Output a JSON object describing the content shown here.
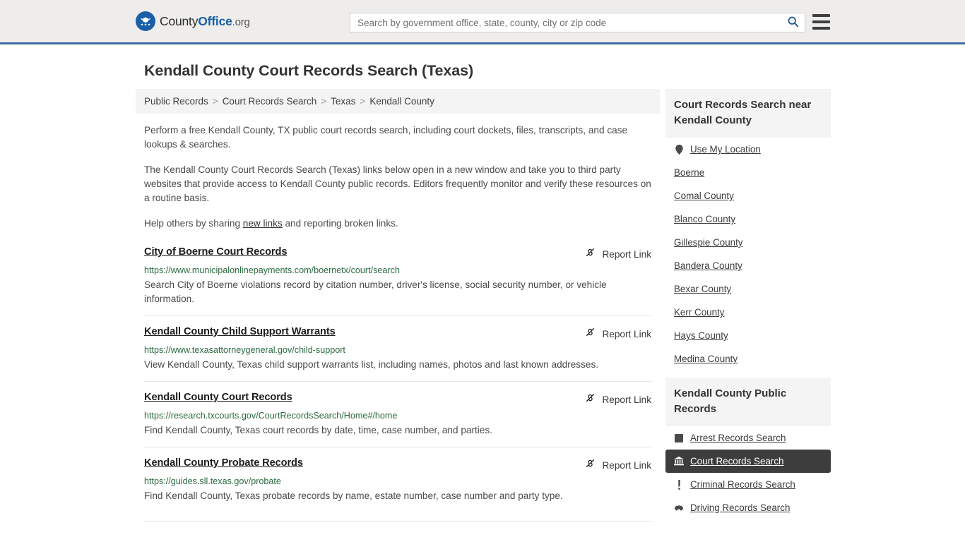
{
  "header": {
    "logo": {
      "part1": "County",
      "part2": "Office",
      "tld": ".org",
      "icon": "eagle-seal-icon"
    },
    "search": {
      "placeholder": "Search by government office, state, county, city or zip code",
      "value": ""
    },
    "search_icon": "search-icon",
    "menu_icon": "hamburger-menu-icon",
    "accent_color": "#3a6ea5",
    "background_color": "#eeedeb"
  },
  "page_title": "Kendall County Court Records Search (Texas)",
  "breadcrumb": {
    "items": [
      {
        "label": "Public Records"
      },
      {
        "label": "Court Records Search"
      },
      {
        "label": "Texas"
      },
      {
        "label": "Kendall County"
      }
    ],
    "separator": ">"
  },
  "intro": {
    "p1": "Perform a free Kendall County, TX public court records search, including court dockets, files, transcripts, and case lookups & searches.",
    "p2": "The Kendall County Court Records Search (Texas) links below open in a new window and take you to third party websites that provide access to Kendall County public records. Editors frequently monitor and verify these resources on a routine basis.",
    "p3_before": "Help others by sharing ",
    "p3_link": "new links",
    "p3_after": " and reporting broken links."
  },
  "results": {
    "report_label": "Report Link",
    "report_icon": "broken-link-icon",
    "items": [
      {
        "title": "City of Boerne Court Records",
        "url": "https://www.municipalonlinepayments.com/boernetx/court/search",
        "description": "Search City of Boerne violations record by citation number, driver's license, social security number, or vehicle information."
      },
      {
        "title": "Kendall County Child Support Warrants",
        "url": "https://www.texasattorneygeneral.gov/child-support",
        "description": "View Kendall County, Texas child support warrants list, including names, photos and last known addresses."
      },
      {
        "title": "Kendall County Court Records",
        "url": "https://research.txcourts.gov/CourtRecordsSearch/Home#/home",
        "description": "Find Kendall County, Texas court records by date, time, case number, and parties."
      },
      {
        "title": "Kendall County Probate Records",
        "url": "https://guides.sll.texas.gov/probate",
        "description": "Find Kendall County, Texas probate records by name, estate number, case number and party type."
      }
    ]
  },
  "sidebar": {
    "nearby": {
      "title": "Court Records Search near Kendall County",
      "items": [
        {
          "label": "Use My Location",
          "icon": "location-pin-icon"
        },
        {
          "label": "Boerne",
          "icon": ""
        },
        {
          "label": "Comal County",
          "icon": ""
        },
        {
          "label": "Blanco County",
          "icon": ""
        },
        {
          "label": "Gillespie County",
          "icon": ""
        },
        {
          "label": "Bandera County",
          "icon": ""
        },
        {
          "label": "Bexar County",
          "icon": ""
        },
        {
          "label": "Kerr County",
          "icon": ""
        },
        {
          "label": "Hays County",
          "icon": ""
        },
        {
          "label": "Medina County",
          "icon": ""
        }
      ]
    },
    "public_records": {
      "title": "Kendall County Public Records",
      "items": [
        {
          "label": "Arrest Records Search",
          "icon": "square-badge-icon",
          "active": false
        },
        {
          "label": "Court Records Search",
          "icon": "courthouse-icon",
          "active": true
        },
        {
          "label": "Criminal Records Search",
          "icon": "exclamation-icon",
          "active": false
        },
        {
          "label": "Driving Records Search",
          "icon": "car-icon",
          "active": false
        }
      ]
    }
  }
}
